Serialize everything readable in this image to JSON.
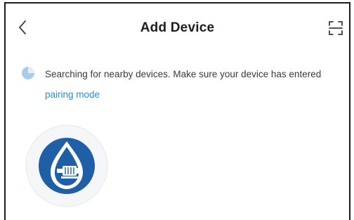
{
  "header": {
    "title": "Add Device",
    "back_icon": "chevron-left-icon",
    "scan_icon": "scan-frame-icon"
  },
  "status": {
    "message": "Searching for nearby devices. Make sure your device has entered",
    "link_text": "pairing mode",
    "spinner_icon": "loading-spinner-icon"
  },
  "device": {
    "icon": "water-drop-pump-icon"
  },
  "colors": {
    "accent_link": "#2a8fd6",
    "device_blue": "#1f5fa6",
    "spinner_blue": "#a9cde8",
    "title_text": "#1e1e1e",
    "body_text": "#3a3a3a"
  }
}
